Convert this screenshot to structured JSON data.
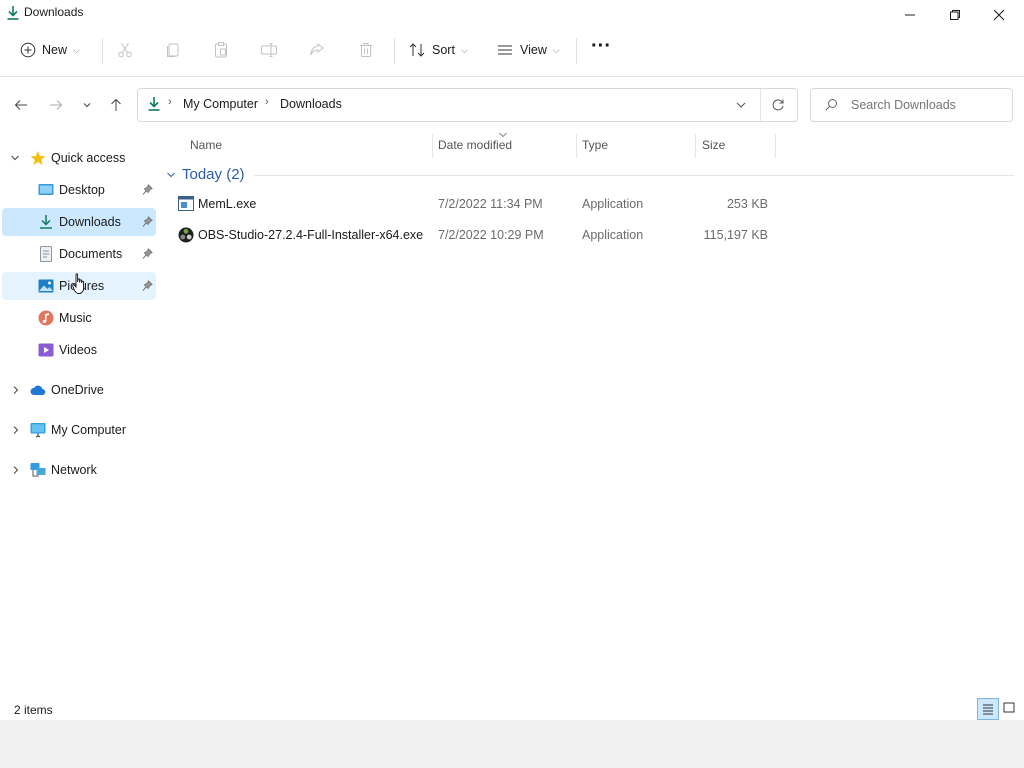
{
  "window": {
    "title": "Downloads",
    "minimize_glyph": "—",
    "maximize_glyph": "❐",
    "close_glyph": "✕"
  },
  "toolbar": {
    "new_label": "New",
    "sort_label": "Sort",
    "view_label": "View",
    "more_glyph": "···",
    "disabled_icons": [
      "cut-icon",
      "copy-icon",
      "paste-icon",
      "rename-icon",
      "share-icon",
      "delete-icon"
    ]
  },
  "address": {
    "crumbs": [
      "My Computer",
      "Downloads"
    ],
    "search_placeholder": "Search Downloads"
  },
  "sidebar": {
    "quick_access": "Quick access",
    "items": [
      {
        "label": "Desktop",
        "icon": "desktop-icon",
        "pinned": true
      },
      {
        "label": "Downloads",
        "icon": "downloads-icon",
        "pinned": true,
        "selected": true
      },
      {
        "label": "Documents",
        "icon": "documents-icon",
        "pinned": true
      },
      {
        "label": "Pictures",
        "icon": "pictures-icon",
        "pinned": true,
        "hover": true
      },
      {
        "label": "Music",
        "icon": "music-icon",
        "pinned": false
      },
      {
        "label": "Videos",
        "icon": "videos-icon",
        "pinned": false
      }
    ],
    "roots": [
      {
        "label": "OneDrive",
        "icon": "cloud-icon"
      },
      {
        "label": "My Computer",
        "icon": "monitor-icon"
      },
      {
        "label": "Network",
        "icon": "network-icon"
      }
    ]
  },
  "columns": {
    "name": "Name",
    "date": "Date modified",
    "type": "Type",
    "size": "Size"
  },
  "group": {
    "label": "Today (2)"
  },
  "files": [
    {
      "name": "MemL.exe",
      "date": "7/2/2022 11:34 PM",
      "type": "Application",
      "size": "253 KB",
      "icon": "exe-app-icon"
    },
    {
      "name": "OBS-Studio-27.2.4-Full-Installer-x64.exe",
      "date": "7/2/2022 10:29 PM",
      "type": "Application",
      "size": "115,197 KB",
      "icon": "obs-app-icon"
    }
  ],
  "status": {
    "item_count": "2 items"
  },
  "colors": {
    "accent": "#0f7b5f",
    "selected_bg": "#cce8ff",
    "hover_bg": "#e5f3ff",
    "group_text": "#2a5ea8"
  }
}
